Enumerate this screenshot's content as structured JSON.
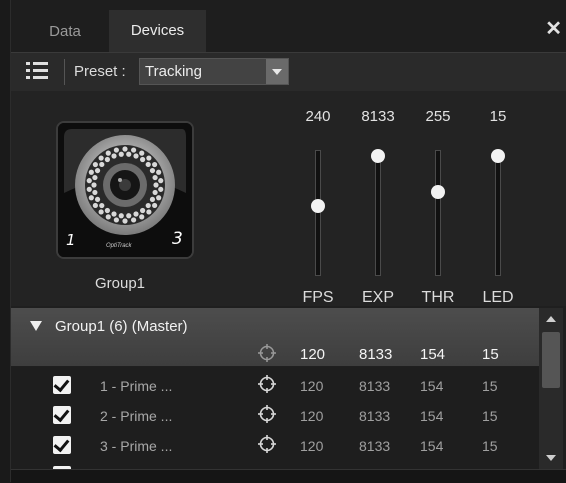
{
  "tabs": [
    {
      "label": "Data"
    },
    {
      "label": "Devices"
    }
  ],
  "close_icon": "close-icon",
  "toolbar": {
    "menu_icon": "list-menu-icon",
    "preset_label": "Preset :",
    "preset_value": "Tracking"
  },
  "device": {
    "group_name": "Group1",
    "camera_left_number": "1",
    "camera_right_number": "3",
    "camera_brand": "OptiTrack"
  },
  "sliders": [
    {
      "label": "FPS",
      "value": "240",
      "level": 0.56
    },
    {
      "label": "EXP",
      "value": "8133",
      "level": 1.0
    },
    {
      "label": "THR",
      "value": "255",
      "level": 0.68
    },
    {
      "label": "LED",
      "value": "15",
      "level": 1.0
    }
  ],
  "group": {
    "title": "Group1 (6) (Master)",
    "fps": "120",
    "exp": "8133",
    "thr": "154",
    "led": "15"
  },
  "devices": [
    {
      "name": "1 - Prime ...",
      "checked": true,
      "fps": "120",
      "exp": "8133",
      "thr": "154",
      "led": "15"
    },
    {
      "name": "2 - Prime ...",
      "checked": true,
      "fps": "120",
      "exp": "8133",
      "thr": "154",
      "led": "15"
    },
    {
      "name": "3 - Prime ...",
      "checked": true,
      "fps": "120",
      "exp": "8133",
      "thr": "154",
      "led": "15"
    }
  ],
  "colors": {
    "background": "#1f1f1f",
    "active_tab": "#2e2e2e",
    "header_gradient": "#4d4d4d"
  }
}
